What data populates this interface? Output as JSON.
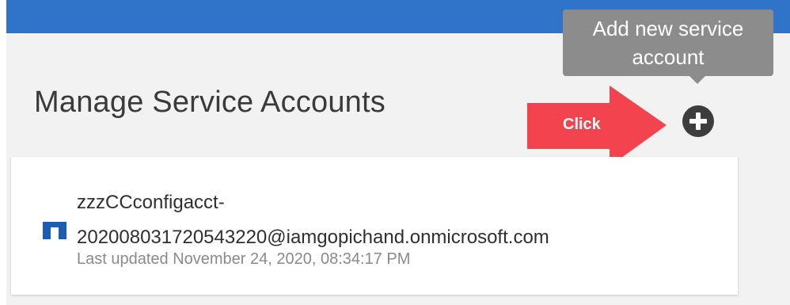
{
  "header": {
    "bar_color": "#2f74c8"
  },
  "page": {
    "title": "Manage Service Accounts"
  },
  "tooltip": {
    "text": "Add new service account"
  },
  "annotation": {
    "label": "Click",
    "color": "#f2434f"
  },
  "add_button": {
    "icon": "plus-circle-icon"
  },
  "accounts": [
    {
      "name_line1": "zzzCCconfigacct-",
      "name_line2": "20200803172054322​0@iamgopichand.onmicrosoft.com",
      "last_updated": "Last updated November 24, 2020, 08:34:17 PM",
      "logo_icon": "netapp-logo-icon"
    }
  ]
}
